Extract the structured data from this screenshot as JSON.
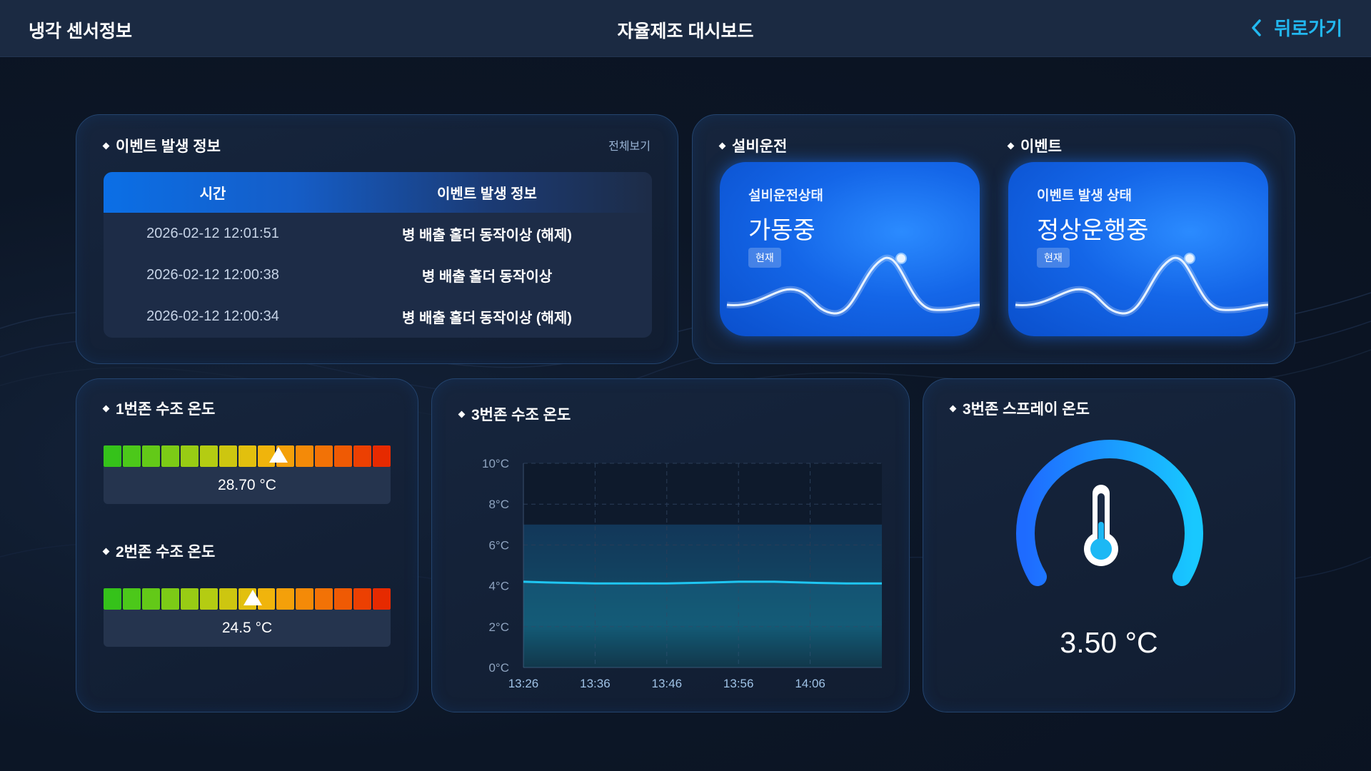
{
  "header": {
    "left_title": "냉각 센서정보",
    "center_title": "자율제조 대시보드",
    "back_label": "뒤로가기"
  },
  "events": {
    "title": "이벤트 발생 정보",
    "view_all": "전체보기",
    "columns": [
      "시간",
      "이벤트 발생 정보"
    ],
    "rows": [
      {
        "time": "2026-02-12 12:01:51",
        "info": "병 배출 홀더 동작이상 (해제)"
      },
      {
        "time": "2026-02-12 12:00:38",
        "info": "병 배출 홀더 동작이상"
      },
      {
        "time": "2026-02-12 12:00:34",
        "info": "병 배출 홀더 동작이상 (해제)"
      }
    ]
  },
  "status": {
    "equipment": {
      "section_title": "설비운전",
      "label": "설비운전상태",
      "value": "가동중",
      "badge": "현재"
    },
    "event": {
      "section_title": "이벤트",
      "label": "이벤트 발생 상태",
      "value": "정상운행중",
      "badge": "현재"
    }
  },
  "zones": {
    "zone1": {
      "title": "1번존 수조 온도",
      "value_text": "28.70 °C",
      "marker_fraction": 0.61
    },
    "zone2": {
      "title": "2번존 수조 온도",
      "value_text": "24.5 °C",
      "marker_fraction": 0.52
    }
  },
  "colors": {
    "segments": [
      "#35c21a",
      "#4cc81a",
      "#63c918",
      "#7ccb16",
      "#98cc14",
      "#b4cc12",
      "#cdc610",
      "#e2c00e",
      "#f0b40c",
      "#f4a00a",
      "#f48a08",
      "#f27206",
      "#ef5a04",
      "#ec4002",
      "#e62a00"
    ],
    "accent": "#22b8f0",
    "line": "#1fc6f2"
  },
  "zone3": {
    "title": "3번존 수조 온도"
  },
  "spray": {
    "title": "3번존 스프레이 온도",
    "value_text": "3.50 °C",
    "icon": "thermometer-icon"
  },
  "chart_data": {
    "type": "area",
    "x": [
      "13:26",
      "13:31",
      "13:36",
      "13:41",
      "13:46",
      "13:51",
      "13:56",
      "14:01",
      "14:06",
      "14:11",
      "14:16"
    ],
    "xticks": [
      "13:26",
      "13:36",
      "13:46",
      "13:56",
      "14:06"
    ],
    "series": [
      {
        "values": [
          4.2,
          4.15,
          4.12,
          4.12,
          4.12,
          4.15,
          4.2,
          4.2,
          4.15,
          4.12,
          4.12
        ]
      }
    ],
    "band": [
      0,
      7
    ],
    "ylim": [
      0,
      10
    ],
    "yticks": [
      "0°C",
      "2°C",
      "4°C",
      "6°C",
      "8°C",
      "10°C"
    ],
    "grid": true
  }
}
